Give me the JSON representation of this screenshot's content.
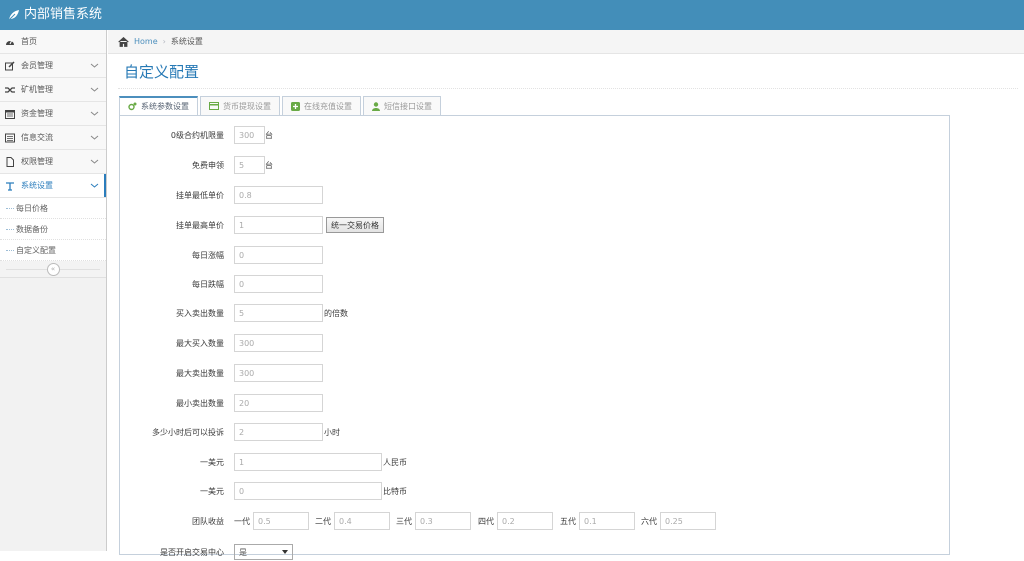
{
  "brand": {
    "title": "内部销售系统",
    "icon": "leaf-icon"
  },
  "sidebar": {
    "items": [
      {
        "label": "首页",
        "icon": "dashboard-icon"
      },
      {
        "label": "会员管理",
        "icon": "edit-icon"
      },
      {
        "label": "矿机管理",
        "icon": "random-icon"
      },
      {
        "label": "资金管理",
        "icon": "calendar-icon"
      },
      {
        "label": "信息交流",
        "icon": "list-icon"
      },
      {
        "label": "权限管理",
        "icon": "file-icon"
      },
      {
        "label": "系统设置",
        "icon": "text-icon"
      }
    ],
    "subitems": [
      {
        "label": "每日价格"
      },
      {
        "label": "数据备份"
      },
      {
        "label": "自定义配置"
      }
    ],
    "collapse_icon": "double-chevron-left-icon"
  },
  "breadcrumb": {
    "home": "Home",
    "current": "系统设置"
  },
  "page": {
    "title": "自定义配置"
  },
  "tabs": [
    {
      "label": "系统参数设置",
      "icon": "cogs-icon",
      "color": "#69aa46"
    },
    {
      "label": "货币提现设置",
      "icon": "credit-card-icon",
      "color": "#69aa46"
    },
    {
      "label": "在线充值设置",
      "icon": "plus-square-icon",
      "color": "#69aa46"
    },
    {
      "label": "短信接口设置",
      "icon": "user-icon",
      "color": "#69aa46"
    }
  ],
  "form": {
    "machine_limit": {
      "label": "0级合约机限量",
      "value": "300",
      "suffix": "台"
    },
    "free_apply": {
      "label": "免费申领",
      "value": "5",
      "suffix": "台"
    },
    "min_price": {
      "label": "挂单最低单价",
      "value": "0.8"
    },
    "max_price": {
      "label": "挂单最高单价",
      "value": "1",
      "button": "统一交易价格"
    },
    "daily_rise": {
      "label": "每日涨幅",
      "value": "0"
    },
    "daily_fall": {
      "label": "每日跌幅",
      "value": "0"
    },
    "trade_qty": {
      "label": "买入卖出数量",
      "value": "5",
      "suffix": "的倍数"
    },
    "max_buy": {
      "label": "最大买入数量",
      "value": "300"
    },
    "max_sell": {
      "label": "最大卖出数量",
      "value": "300"
    },
    "min_sell": {
      "label": "最小卖出数量",
      "value": "20"
    },
    "complaint_hours": {
      "label": "多少小时后可以投诉",
      "value": "2",
      "suffix": "小时"
    },
    "usd_cny": {
      "label": "一美元",
      "value": "1",
      "suffix": "人民币"
    },
    "usd_btc": {
      "label": "一美元",
      "value": "0",
      "suffix": "比特币"
    },
    "team": {
      "label": "团队收益",
      "gens": [
        {
          "label": "一代",
          "value": "0.5"
        },
        {
          "label": "二代",
          "value": "0.4"
        },
        {
          "label": "三代",
          "value": "0.3"
        },
        {
          "label": "四代",
          "value": "0.2"
        },
        {
          "label": "五代",
          "value": "0.1"
        },
        {
          "label": "六代",
          "value": "0.25"
        }
      ]
    },
    "trade_center": {
      "label": "是否开启交易中心",
      "value": "是"
    }
  }
}
